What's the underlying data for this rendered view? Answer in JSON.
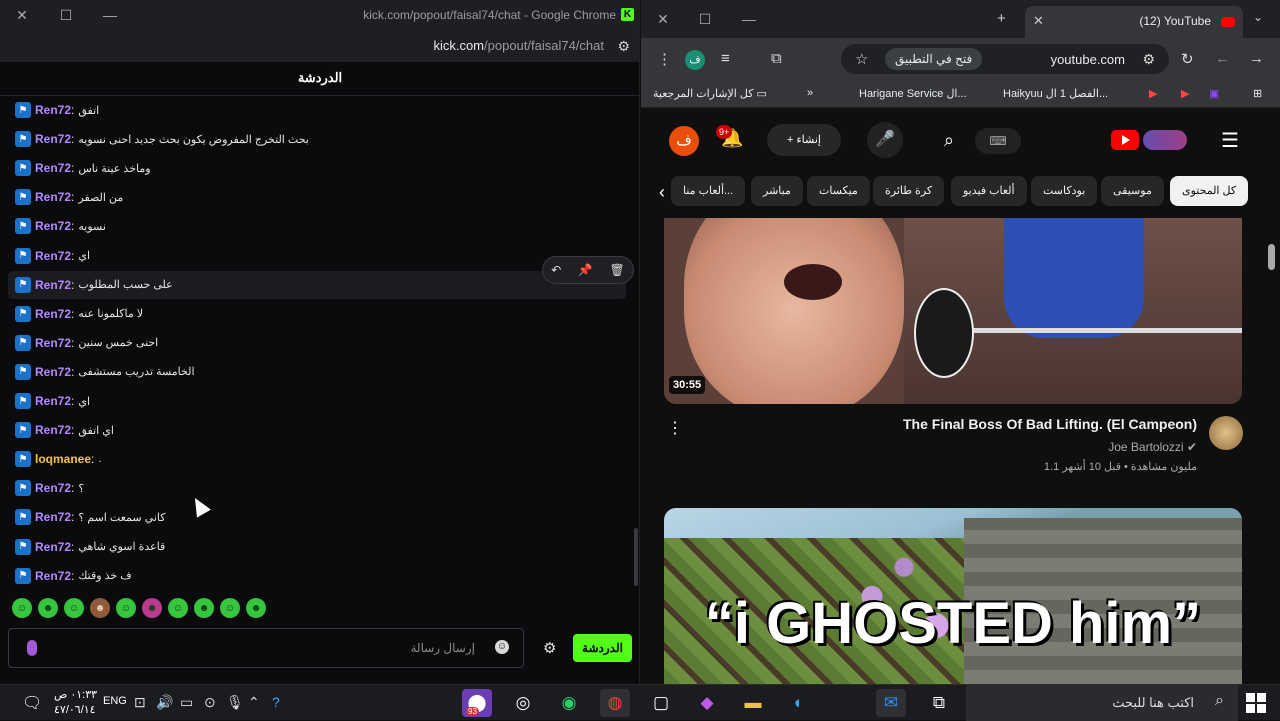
{
  "left_window": {
    "title": "kick.com/popout/faisal74/chat - Google Chrome",
    "url_host": "kick.com",
    "url_path": "/popout/faisal74/chat",
    "chat_header": "الدردشة",
    "messages": [
      {
        "user": "Ren72",
        "text": "اتفق",
        "color": "#b388ff"
      },
      {
        "user": "Ren72",
        "text": "بحث التخرج المفروض يكون بحث جديد احنى نسويه",
        "color": "#b388ff"
      },
      {
        "user": "Ren72",
        "text": "وماخذ عينة ناس",
        "color": "#b388ff"
      },
      {
        "user": "Ren72",
        "text": "من الصفر",
        "color": "#b388ff"
      },
      {
        "user": "Ren72",
        "text": "نسويه",
        "color": "#b388ff"
      },
      {
        "user": "Ren72",
        "text": "اي",
        "color": "#b388ff"
      },
      {
        "user": "Ren72",
        "text": "على حسب المطلوب",
        "color": "#b388ff"
      },
      {
        "user": "Ren72",
        "text": "لا ماكلمونا عنه",
        "color": "#b388ff"
      },
      {
        "user": "Ren72",
        "text": "احنى خمس سنين",
        "color": "#b388ff"
      },
      {
        "user": "Ren72",
        "text": "الخامسة تدريب مستشفى",
        "color": "#b388ff"
      },
      {
        "user": "Ren72",
        "text": "اي",
        "color": "#b388ff"
      },
      {
        "user": "Ren72",
        "text": "اي اتفق",
        "color": "#b388ff"
      },
      {
        "user": "loqmanee",
        "text": ".",
        "color": "#f5c542"
      },
      {
        "user": "Ren72",
        "text": "؟",
        "color": "#b388ff"
      },
      {
        "user": "Ren72",
        "text": "كاني سمعت اسم ؟",
        "color": "#b388ff"
      },
      {
        "user": "Ren72",
        "text": "قاعدة اسوي شاهي",
        "color": "#b388ff"
      },
      {
        "user": "Ren72",
        "text": "ف خذ وقتك",
        "color": "#b388ff"
      }
    ],
    "composer_placeholder": "إرسال رسالة",
    "send_button": "الدردشة"
  },
  "right_window": {
    "tab_title": "(12) YouTube",
    "omnibox_url": "youtube.com",
    "open_in_app": "فتح في التطبيق",
    "bookmarks": {
      "all_bookmarks": "كل الإشارات المرجعية",
      "item1": "Harigane Service ال...",
      "item2": "Haikyuu الفصل 1 ال..."
    },
    "header": {
      "avatar_letter": "ف",
      "notif_count": "9+",
      "create_label": "إنشاء",
      "keyboard_glyph": "⌨"
    },
    "chips": [
      "كل المحتوى",
      "موسيقى",
      "بودكاست",
      "ألعاب فيديو",
      "كرة طائرة",
      "ميكسات",
      "مباشر",
      "ألعاب منا..."
    ],
    "video1": {
      "duration": "30:55",
      "title": "The Final Boss Of Bad Lifting. (El Campeon)",
      "channel": "Joe Bartolozzi",
      "meta": "1.1 مليون مشاهدة • قبل 10 أشهر"
    },
    "video2": {
      "thumb_text": "“i GHOSTED him”"
    }
  },
  "taskbar": {
    "time": "٠١:٣٣ ص",
    "date": "٤٧/٠٦/١٤",
    "lang": "ENG",
    "search_placeholder": "اكتب هنا للبحث",
    "badge": "93"
  }
}
